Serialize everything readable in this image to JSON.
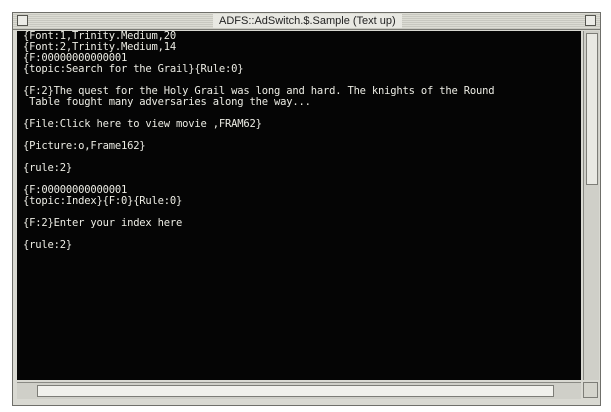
{
  "window": {
    "title": "ADFS::AdSwitch.$.Sample (Text up)"
  },
  "editor": {
    "lines": [
      "{Font:1,Trinity.Medium,20",
      "{Font:2,Trinity.Medium,14",
      "{F:00000000000001",
      "{topic:Search for the Grail}{Rule:0}",
      "",
      "{F:2}The quest for the Holy Grail was long and hard. The knights of the Round",
      " Table fought many adversaries along the way...",
      "",
      "{File:Click here to view movie ,FRAM62}",
      "",
      "{Picture:o,Frame162}",
      "",
      "{rule:2}",
      "",
      "{F:00000000000001",
      "{topic:Index}{F:0}{Rule:0}",
      "",
      "{F:2}Enter your index here",
      "",
      "{rule:2}"
    ]
  },
  "colors": {
    "text": "#ecece4",
    "background": "#050505",
    "window_chrome": "#d9d9d2"
  }
}
